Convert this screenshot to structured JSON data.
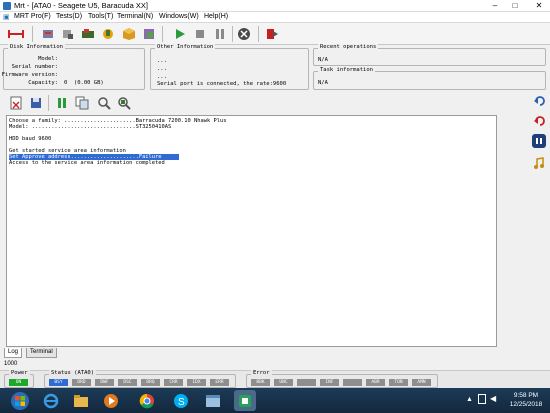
{
  "window": {
    "title": "Mrt - [ATA0 - Seagete U5, Baracuda XX]",
    "min": "–",
    "max": "□",
    "close": "✕"
  },
  "menu": [
    "MRT Pro(F)",
    "Tests(D)",
    "Tools(T)",
    "Terminal(N)",
    "Windows(W)",
    "Help(H)"
  ],
  "disk_info": {
    "title": "Disk Information",
    "model_label": "Model:",
    "serial_label": "Serial number:",
    "firmware_label": "Firmware version:",
    "capacity_label": "Capacity:",
    "capacity_value": "0  (0.00 GB)"
  },
  "other_info": {
    "title": "Other Information",
    "l1": "...",
    "l2": "...",
    "l3": "...",
    "status": "Serial port is connected, the rate:9600"
  },
  "recent_ops": {
    "title": "Recent operations",
    "value": "N/A"
  },
  "task_info": {
    "title": "Task information",
    "value": "N/A"
  },
  "log_lines": [
    "Choose a family: ......................Barracuda 7200.10 Nhawk Plus",
    "Model: ................................ST3250410AS",
    "",
    "HDD baud 9600",
    "",
    "Get started service area information",
    "Set Approve address.....................Failure",
    "Access to the service area information completed"
  ],
  "tabs": {
    "log": "Log",
    "terminal": "Terminal"
  },
  "status_value": "1000",
  "power": {
    "title": "Power",
    "state": "ON"
  },
  "ata_status": {
    "title": "Status (ATA0)",
    "flags": [
      "BSY",
      "DRD",
      "DWF",
      "DSC",
      "DRQ",
      "CRR",
      "IDX",
      "ERR"
    ]
  },
  "error": {
    "title": "Error",
    "flags": [
      "BBK",
      "UNC",
      "",
      "INF",
      "",
      "ABR",
      "TON",
      "AMN"
    ]
  },
  "clock": {
    "time": "9:58 PM",
    "date": "12/25/2018"
  },
  "colors": {
    "accent": "#2f6bd3",
    "power_on": "#1ea82a",
    "taskbar": "#1c3b57"
  }
}
